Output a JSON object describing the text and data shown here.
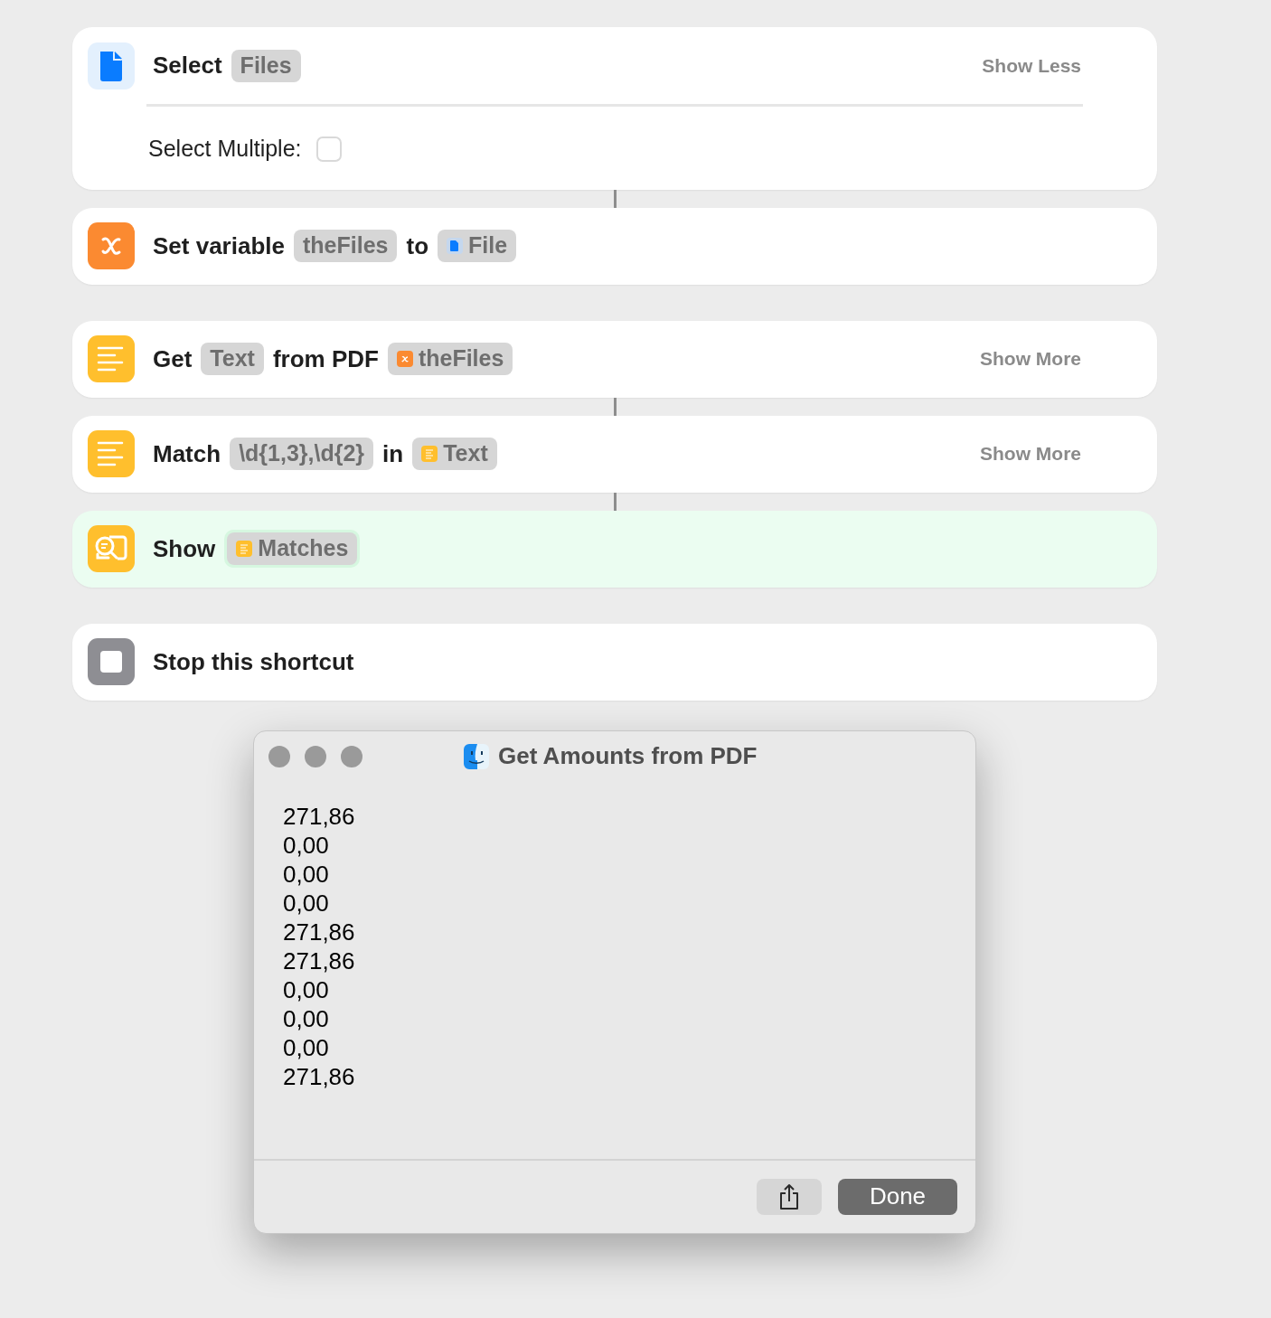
{
  "actions": [
    {
      "kind": "select_files",
      "highlighted": false,
      "parts": [
        {
          "kind": "word",
          "text": "Select"
        },
        {
          "kind": "token",
          "text": "Files"
        }
      ],
      "toggle": "Show Less",
      "option": {
        "label": "Select Multiple:",
        "checked": false
      }
    },
    {
      "kind": "set_variable",
      "linked": true,
      "highlighted": false,
      "parts": [
        {
          "kind": "word",
          "text": "Set variable"
        },
        {
          "kind": "token",
          "text": "theFiles"
        },
        {
          "kind": "word",
          "text": "to"
        },
        {
          "kind": "file_token",
          "text": "File"
        }
      ]
    },
    {
      "kind": "text_action",
      "linked": false,
      "highlighted": false,
      "parts": [
        {
          "kind": "word",
          "text": "Get"
        },
        {
          "kind": "token",
          "text": "Text"
        },
        {
          "kind": "word",
          "text": "from PDF"
        },
        {
          "kind": "variable_token",
          "text": "theFiles"
        }
      ],
      "toggle": "Show More"
    },
    {
      "kind": "text_action",
      "linked": true,
      "highlighted": false,
      "parts": [
        {
          "kind": "word",
          "text": "Match"
        },
        {
          "kind": "token",
          "text": "\\d{1,3},\\d{2}"
        },
        {
          "kind": "word",
          "text": "in"
        },
        {
          "kind": "text_token",
          "text": "Text"
        }
      ],
      "toggle": "Show More"
    },
    {
      "kind": "show_result",
      "linked": true,
      "highlighted": true,
      "parts": [
        {
          "kind": "word",
          "text": "Show"
        },
        {
          "kind": "text_token",
          "text": "Matches"
        }
      ]
    },
    {
      "kind": "stop",
      "linked": false,
      "highlighted": false,
      "parts": [
        {
          "kind": "word",
          "text": "Stop this shortcut"
        }
      ]
    }
  ],
  "dialog": {
    "title": "Get Amounts from PDF",
    "lines": [
      "271,86",
      "0,00",
      "0,00",
      "0,00",
      "271,86",
      "271,86",
      "0,00",
      "0,00",
      "0,00",
      "271,86"
    ],
    "done_button": "Done"
  }
}
